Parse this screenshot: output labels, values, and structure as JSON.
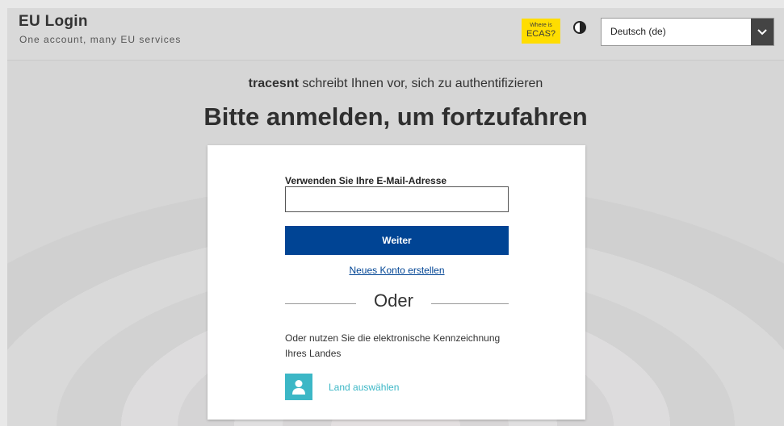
{
  "header": {
    "brand_title": "EU Login",
    "brand_subtitle": "One account, many EU services",
    "ecas_small": "Where is",
    "ecas_big": "ECAS?",
    "contrast_icon": "contrast-icon",
    "language_selected": "Deutsch (de)"
  },
  "main": {
    "requester": "tracesnt",
    "requester_text": " schreibt Ihnen vor, sich zu authentifizieren",
    "title": "Bitte anmelden, um fortzufahren"
  },
  "form": {
    "email_label": "Verwenden Sie Ihre E-Mail-Adresse",
    "email_value": "",
    "submit_label": "Weiter",
    "create_account_link": "Neues Konto erstellen",
    "or_label": "Oder",
    "eid_text": "Oder nutzen Sie die elektronische Kennzeichnung Ihres Landes",
    "country_icon": "person-icon",
    "country_link": "Land auswählen"
  },
  "colors": {
    "primary": "#004494",
    "badge": "#ffdd00",
    "accent": "#3cb7c6"
  }
}
